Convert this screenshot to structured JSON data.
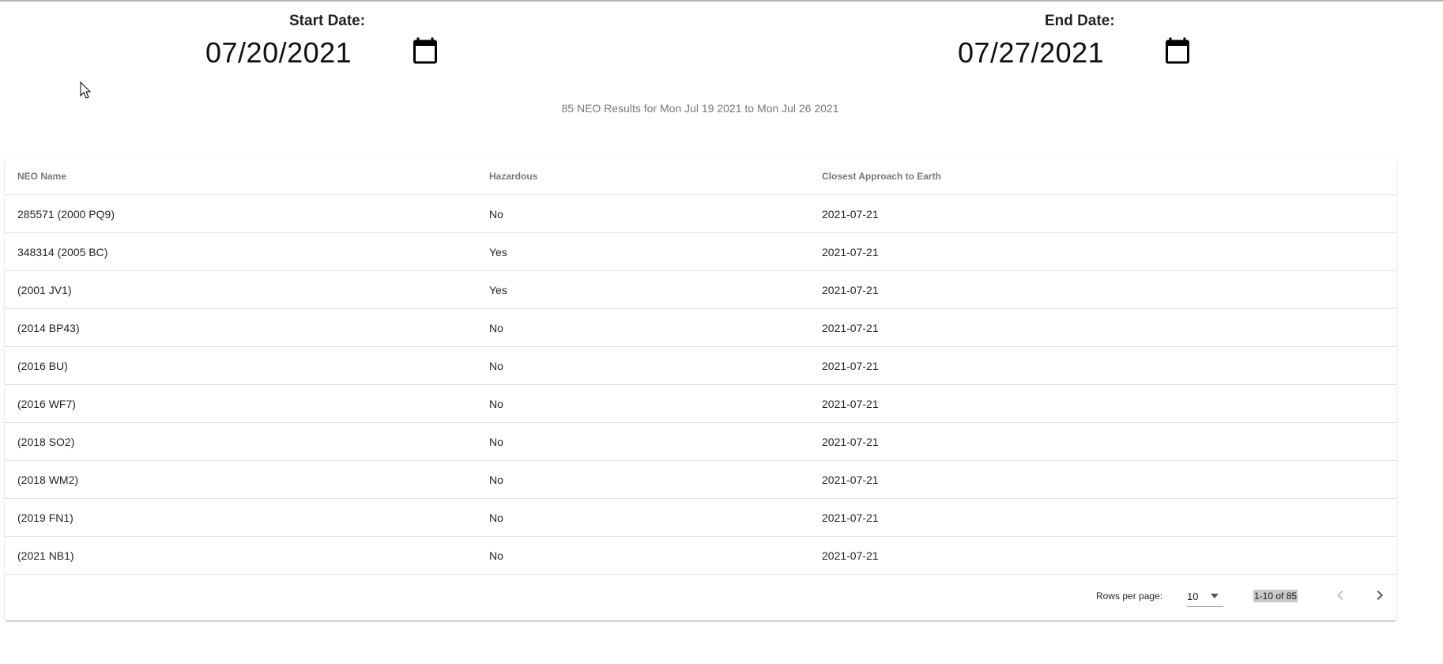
{
  "dates": {
    "start": {
      "label": "Start Date:",
      "value": "07/20/2021"
    },
    "end": {
      "label": "End Date:",
      "value": "07/27/2021"
    }
  },
  "summary": "85 NEO Results for Mon Jul 19 2021 to Mon Jul 26 2021",
  "table": {
    "headers": [
      "NEO Name",
      "Hazardous",
      "Closest Approach to Earth"
    ],
    "rows": [
      [
        "285571 (2000 PQ9)",
        "No",
        "2021-07-21"
      ],
      [
        "348314 (2005 BC)",
        "Yes",
        "2021-07-21"
      ],
      [
        "(2001 JV1)",
        "Yes",
        "2021-07-21"
      ],
      [
        "(2014 BP43)",
        "No",
        "2021-07-21"
      ],
      [
        "(2016 BU)",
        "No",
        "2021-07-21"
      ],
      [
        "(2016 WF7)",
        "No",
        "2021-07-21"
      ],
      [
        "(2018 SO2)",
        "No",
        "2021-07-21"
      ],
      [
        "(2018 WM2)",
        "No",
        "2021-07-21"
      ],
      [
        "(2019 FN1)",
        "No",
        "2021-07-21"
      ],
      [
        "(2021 NB1)",
        "No",
        "2021-07-21"
      ]
    ]
  },
  "pagination": {
    "rows_per_page_label": "Rows per page:",
    "rows_per_page_value": "10",
    "range": "1-10 of 85"
  },
  "icons": {
    "calendar": "calendar-icon",
    "dropdown": "arrow-drop-down-icon",
    "prev": "chevron-left-icon",
    "next": "chevron-right-icon",
    "cursor": "mouse-pointer-icon"
  },
  "colors": {
    "range_highlight": "#c8c8c8",
    "disabled": "#bdbdbd",
    "divider": "#e0e0e0"
  }
}
